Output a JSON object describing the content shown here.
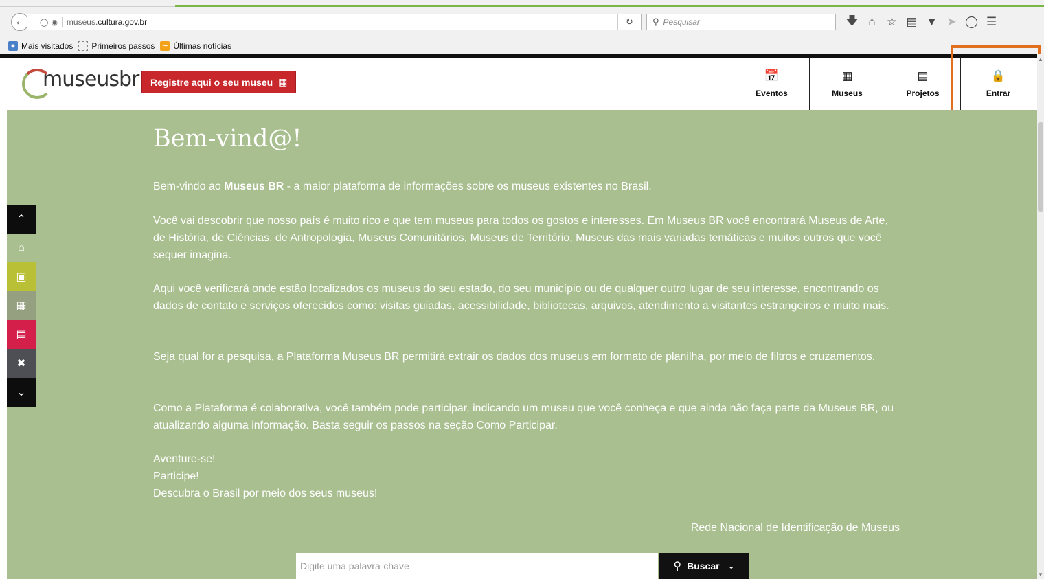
{
  "browser": {
    "url_prefix": "museus.",
    "url_domain": "cultura.gov.br",
    "search_placeholder": "Pesquisar",
    "bookmarks": [
      {
        "label": "Mais visitados"
      },
      {
        "label": "Primeiros passos"
      },
      {
        "label": "Últimas notícias"
      }
    ]
  },
  "header": {
    "logo_text": "museus",
    "logo_suffix": "br",
    "logo_tagline": "Rede Nacional de Identificação de Museus",
    "register_label": "Registre aqui o seu museu",
    "nav": [
      {
        "label": "Eventos",
        "icon": "calendar-icon"
      },
      {
        "label": "Museus",
        "icon": "building-icon"
      },
      {
        "label": "Projetos",
        "icon": "document-icon"
      },
      {
        "label": "Entrar",
        "icon": "lock-icon"
      }
    ]
  },
  "main": {
    "title": "Bem-vind@!",
    "intro_prefix": "Bem-vindo ao ",
    "intro_bold": "Museus BR",
    "intro_suffix": " - a maior plataforma de informações sobre os museus existentes no Brasil.",
    "paragraphs": [
      "Você vai descobrir que nosso país é muito rico e que tem museus para todos os gostos e interesses. Em Museus BR você encontrará Museus de Arte, de História, de Ciências, de Antropologia, Museus Comunitários, Museus de Território, Museus das mais variadas temáticas e muitos outros que você sequer imagina.",
      "Aqui você verificará onde estão localizados os museus do seu estado, do seu município ou de qualquer outro lugar de seu interesse, encontrando os dados de contato e serviços oferecidos como: visitas guiadas, acessibilidade, bibliotecas, arquivos, atendimento a visitantes estrangeiros e muito mais.",
      "Seja qual for a pesquisa, a Plataforma Museus BR permitirá extrair os dados dos museus em formato de planilha, por meio de filtros e cruzamentos.",
      "Como a Plataforma é colaborativa, você também pode participar, indicando um museu que você conheça e que ainda não faça parte da Museus BR, ou atualizando alguma informação. Basta seguir os passos na seção Como Participar."
    ],
    "closing": [
      "Aventure-se!",
      "Participe!",
      "Descubra o Brasil por meio dos seus museus!"
    ],
    "signature": "Rede Nacional de Identificação de Museus",
    "search_placeholder": "Digite uma palavra-chave",
    "search_button": "Buscar"
  },
  "colors": {
    "main_bg": "#a9bf8f",
    "register_red": "#c8282c",
    "highlight_orange": "#e07020",
    "side_calendar": "#b9c036",
    "side_projects": "#d51f4b"
  }
}
